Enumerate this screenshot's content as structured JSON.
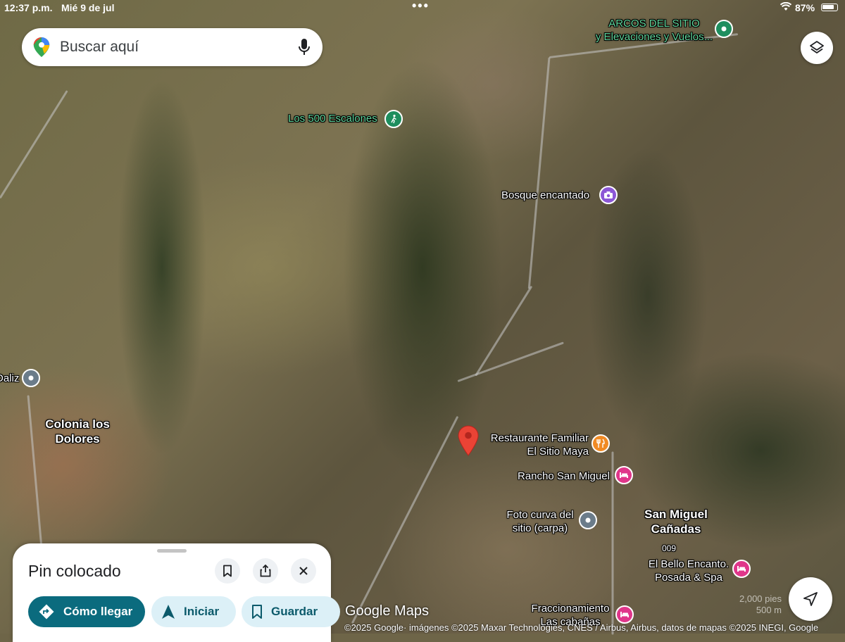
{
  "status": {
    "time": "12:37 p.m.",
    "date": "Mié 9 de jul",
    "battery": "87%"
  },
  "search": {
    "placeholder": "Buscar aquí"
  },
  "map": {
    "pois": [
      {
        "label": "ARCOS DEL SITIO\ny Elevaciones y Vuelos...",
        "icon": "park-icon",
        "color": "#1e8e5e"
      },
      {
        "label": "Los 500 Escalones",
        "icon": "trail-icon",
        "color": "#1e8e5e"
      },
      {
        "label": "Bosque encantado",
        "icon": "camera-icon",
        "color": "#8c57d6"
      },
      {
        "label": "Restaurante Familiar\nEl Sitio Maya",
        "icon": "fork-knife-icon",
        "color": "#f08a24"
      },
      {
        "label": "Rancho San Miguel",
        "icon": "bed-icon",
        "color": "#e0368a"
      },
      {
        "label": "Foto curva del\nsitio (carpa)",
        "icon": "location-dot-icon",
        "color": "#6b7c8a"
      },
      {
        "label": "El Bello Encanto.\nPosada & Spa",
        "icon": "bed-icon",
        "color": "#e0368a"
      },
      {
        "label": "Fraccionamiento\nLas cabañas",
        "icon": "bed-icon",
        "color": "#e0368a"
      },
      {
        "label": "Daliz",
        "icon": "location-dot-icon",
        "color": "#6b7c8a"
      }
    ],
    "places": {
      "colonia": "Colonia los\nDolores",
      "san_miguel": "San Miguel\nCañadas",
      "marker_009": "009"
    },
    "scale": {
      "imperial": "2,000 pies",
      "metric": "500 m"
    },
    "google_mark": "Google Maps",
    "attribution": "©2025 Google· imágenes ©2025 Maxar Technologies, CNES / Airbus, Airbus, datos de mapas ©2025 INEGI, Google"
  },
  "sheet": {
    "title": "Pin colocado",
    "directions_label": "Cómo llegar",
    "start_label": "Iniciar",
    "save_label": "Guardar"
  },
  "colors": {
    "accent": "#0b6b7e",
    "accent_light": "#dcf0f7",
    "pin_red": "#ea4335"
  }
}
